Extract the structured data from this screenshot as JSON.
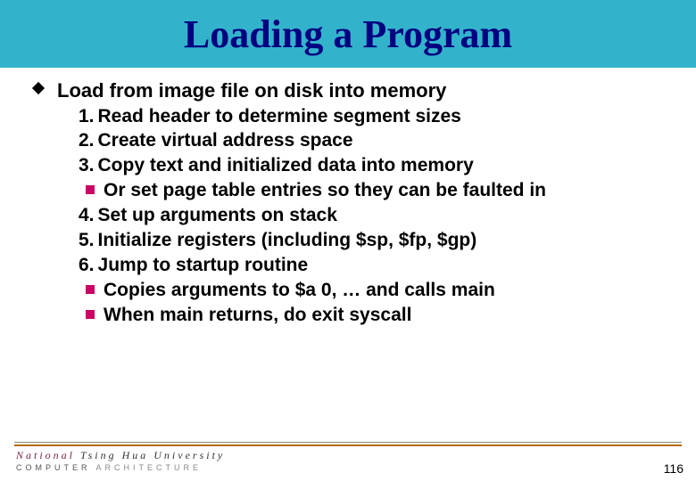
{
  "title": "Loading a Program",
  "bullet": {
    "intro": "Load from image file on disk into memory",
    "items": [
      {
        "num": "1.",
        "text": "Read header to determine segment sizes"
      },
      {
        "num": "2.",
        "text": "Create virtual address space"
      },
      {
        "num": "3.",
        "text": "Copy text and initialized data into memory",
        "sub": [
          {
            "lead": "Or",
            "rest": " set page table entries so they can be faulted in"
          }
        ]
      },
      {
        "num": "4.",
        "text": "Set up arguments on stack"
      },
      {
        "num": "5.",
        "text": "Initialize registers (including $sp, $fp, $gp)"
      },
      {
        "num": "6.",
        "text": "Jump to startup routine",
        "sub": [
          {
            "lead": "Copies",
            "rest": " arguments to $a 0, … and calls main"
          },
          {
            "lead": "When",
            "rest": " main returns, do exit syscall"
          }
        ]
      }
    ]
  },
  "footer": {
    "uni_prefix": "National",
    "uni_rest": " Tsing Hua University",
    "dept_prefix": "COMPUTER",
    "dept_rest": " ARCHITECTURE"
  },
  "page_number": "116"
}
